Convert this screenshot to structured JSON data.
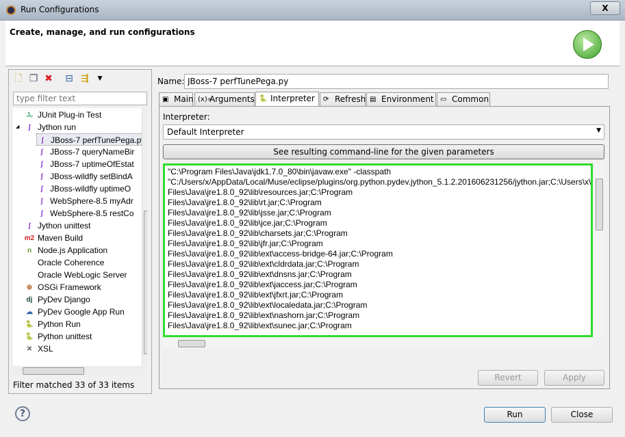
{
  "window": {
    "title": "Run Configurations",
    "close_label": "X"
  },
  "header": {
    "title": "Create, manage, and run configurations"
  },
  "left": {
    "filter_placeholder": "type filter text",
    "tree": [
      {
        "label": "JUnit Plug-in Test",
        "icon": "junit-plugin-icon",
        "level": 1
      },
      {
        "label": "Jython run",
        "icon": "jython-icon",
        "level": 1,
        "expanded": true
      },
      {
        "label": "JBoss-7 perfTunePega.py",
        "display": "JBoss-7 perfTunePega.",
        "icon": "jython-config-icon",
        "level": 2,
        "selected": true
      },
      {
        "label": "JBoss-7 queryNameBir",
        "icon": "jython-config-icon",
        "level": 2
      },
      {
        "label": "JBoss-7 uptimeOfEstat",
        "icon": "jython-config-icon",
        "level": 2
      },
      {
        "label": "JBoss-wildfly setBindA",
        "icon": "jython-config-icon",
        "level": 2
      },
      {
        "label": "JBoss-wildfly uptimeO",
        "icon": "jython-config-icon",
        "level": 2
      },
      {
        "label": "WebSphere-8.5 myAdr",
        "icon": "jython-config-icon",
        "level": 2
      },
      {
        "label": "WebSphere-8.5 restCo",
        "icon": "jython-config-icon",
        "level": 2
      },
      {
        "label": "Jython unittest",
        "icon": "jython-unittest-icon",
        "level": 1
      },
      {
        "label": "Maven Build",
        "icon": "maven-icon",
        "level": 1
      },
      {
        "label": "Node.js Application",
        "icon": "nodejs-icon",
        "level": 1
      },
      {
        "label": "Oracle Coherence",
        "icon": "",
        "level": 1
      },
      {
        "label": "Oracle WebLogic Server",
        "icon": "",
        "level": 1
      },
      {
        "label": "OSGi Framework",
        "icon": "osgi-icon",
        "level": 1
      },
      {
        "label": "PyDev Django",
        "icon": "django-icon",
        "level": 1
      },
      {
        "label": "PyDev Google App Run",
        "icon": "google-app-icon",
        "level": 1
      },
      {
        "label": "Python Run",
        "icon": "python-icon",
        "level": 1
      },
      {
        "label": "Python unittest",
        "icon": "python-unittest-icon",
        "level": 1
      },
      {
        "label": "XSL",
        "icon": "xsl-icon",
        "level": 1
      }
    ],
    "status": "Filter matched 33 of 33 items"
  },
  "right": {
    "name_label": "Name:",
    "name_value": "JBoss-7 perfTunePega.py",
    "tabs": [
      {
        "label": "Main",
        "icon": "main-icon"
      },
      {
        "label": "Arguments",
        "icon": "arguments-icon"
      },
      {
        "label": "Interpreter",
        "icon": "interpreter-icon",
        "active": true
      },
      {
        "label": "Refresh",
        "icon": "refresh-icon"
      },
      {
        "label": "Environment",
        "icon": "environment-icon"
      },
      {
        "label": "Common",
        "icon": "common-icon"
      }
    ],
    "interpreter_label": "Interpreter:",
    "interpreter_value": "Default Interpreter",
    "cmd_button": "See resulting command-line for the given parameters",
    "cmd_lines": [
      "\"C:\\Program Files\\Java\\jdk1.7.0_80\\bin\\javaw.exe\" -classpath",
      "\"C:/Users/x/AppData/Local/Muse/eclipse/plugins/org.python.pydev.jython_5.1.2.201606231256/jython.jar;C:\\Users\\x\\",
      "Files\\Java\\jre1.8.0_92\\lib\\resources.jar;C:\\Program",
      "Files\\Java\\jre1.8.0_92\\lib\\rt.jar;C:\\Program",
      "Files\\Java\\jre1.8.0_92\\lib\\jsse.jar;C:\\Program",
      "Files\\Java\\jre1.8.0_92\\lib\\jce.jar;C:\\Program",
      "Files\\Java\\jre1.8.0_92\\lib\\charsets.jar;C:\\Program",
      "Files\\Java\\jre1.8.0_92\\lib\\jfr.jar;C:\\Program",
      "Files\\Java\\jre1.8.0_92\\lib\\ext\\access-bridge-64.jar;C:\\Program",
      "Files\\Java\\jre1.8.0_92\\lib\\ext\\cldrdata.jar;C:\\Program",
      "Files\\Java\\jre1.8.0_92\\lib\\ext\\dnsns.jar;C:\\Program",
      "Files\\Java\\jre1.8.0_92\\lib\\ext\\jaccess.jar;C:\\Program",
      "Files\\Java\\jre1.8.0_92\\lib\\ext\\jfxrt.jar;C:\\Program",
      "Files\\Java\\jre1.8.0_92\\lib\\ext\\localedata.jar;C:\\Program",
      "Files\\Java\\jre1.8.0_92\\lib\\ext\\nashorn.jar;C:\\Program",
      "Files\\Java\\jre1.8.0_92\\lib\\ext\\sunec.jar;C:\\Program"
    ],
    "revert_label": "Revert",
    "apply_label": "Apply"
  },
  "footer": {
    "run_label": "Run",
    "close_label": "Close",
    "help_label": "?"
  },
  "colors": {
    "highlight_border": "#2fdc2f",
    "run_icon": "#3fa32c"
  }
}
